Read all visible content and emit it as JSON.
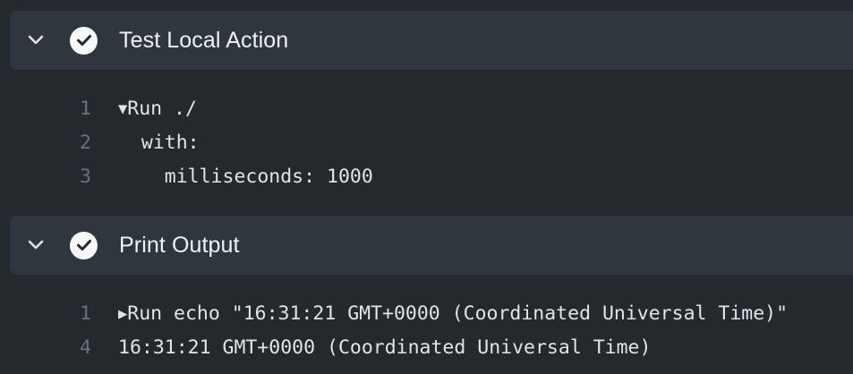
{
  "steps": [
    {
      "title": "Test Local Action",
      "status": "success",
      "expanded": true,
      "lines": [
        {
          "num": "1",
          "toggle": "▼",
          "text": "Run ./"
        },
        {
          "num": "2",
          "toggle": "",
          "text": "  with:"
        },
        {
          "num": "3",
          "toggle": "",
          "text": "    milliseconds: 1000"
        }
      ]
    },
    {
      "title": "Print Output",
      "status": "success",
      "expanded": true,
      "lines": [
        {
          "num": "1",
          "toggle": "▶",
          "text": "Run echo \"16:31:21 GMT+0000 (Coordinated Universal Time)\""
        },
        {
          "num": "4",
          "toggle": "",
          "text": "16:31:21 GMT+0000 (Coordinated Universal Time)"
        }
      ]
    }
  ],
  "icons": {
    "collapse": "chevron-down-icon",
    "status": "check-circle-icon"
  },
  "colors": {
    "background": "#24292e",
    "header": "#2f363d",
    "text": "#e1e4e8",
    "line_number": "#6a737d"
  }
}
